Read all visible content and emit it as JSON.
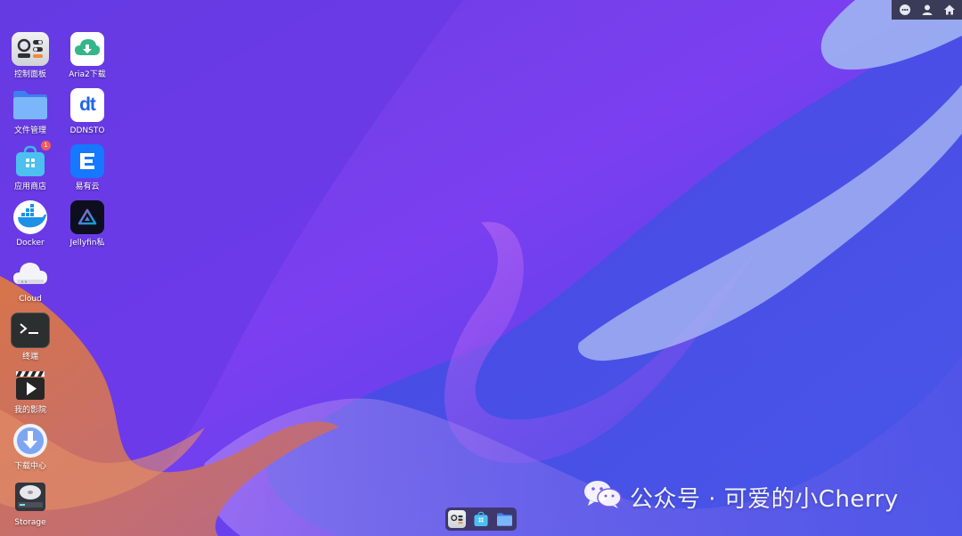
{
  "wallpaper": {
    "colors": {
      "base": "#5a33e0",
      "violet": "#8b3cf0",
      "blue": "#3d44e6",
      "orange": "#e0895a",
      "lightblue": "#9fb4f2"
    }
  },
  "top_bar": {
    "items": [
      {
        "icon": "chat-icon"
      },
      {
        "icon": "user-icon"
      },
      {
        "icon": "home-icon"
      }
    ]
  },
  "desktop": {
    "column1": [
      {
        "label": "控制面板",
        "icon": "control-panel-icon"
      },
      {
        "label": "文件管理",
        "icon": "folder-icon"
      },
      {
        "label": "应用商店",
        "icon": "app-store-icon",
        "badge": "1"
      },
      {
        "label": "Docker",
        "icon": "docker-icon"
      },
      {
        "label": "Cloud",
        "icon": "cloud-icon"
      },
      {
        "label": "终端",
        "icon": "terminal-icon"
      },
      {
        "label": "我的影院",
        "icon": "clapperboard-icon"
      },
      {
        "label": "下载中心",
        "icon": "download-center-icon"
      },
      {
        "label": "Storage",
        "icon": "storage-icon"
      }
    ],
    "column2": [
      {
        "label": "Aria2下载",
        "icon": "aria2-icon"
      },
      {
        "label": "DDNSTO",
        "icon": "ddnsto-icon",
        "glyph": "dt"
      },
      {
        "label": "易有云",
        "icon": "yiyouyun-icon"
      },
      {
        "label": "Jellyfin私",
        "icon": "jellyfin-icon"
      }
    ]
  },
  "dock": {
    "items": [
      {
        "icon": "control-panel-icon"
      },
      {
        "icon": "app-store-icon"
      },
      {
        "icon": "folder-icon"
      }
    ]
  },
  "watermark": {
    "text": "公众号 · 可爱的小Cherry",
    "icon": "wechat-icon"
  }
}
